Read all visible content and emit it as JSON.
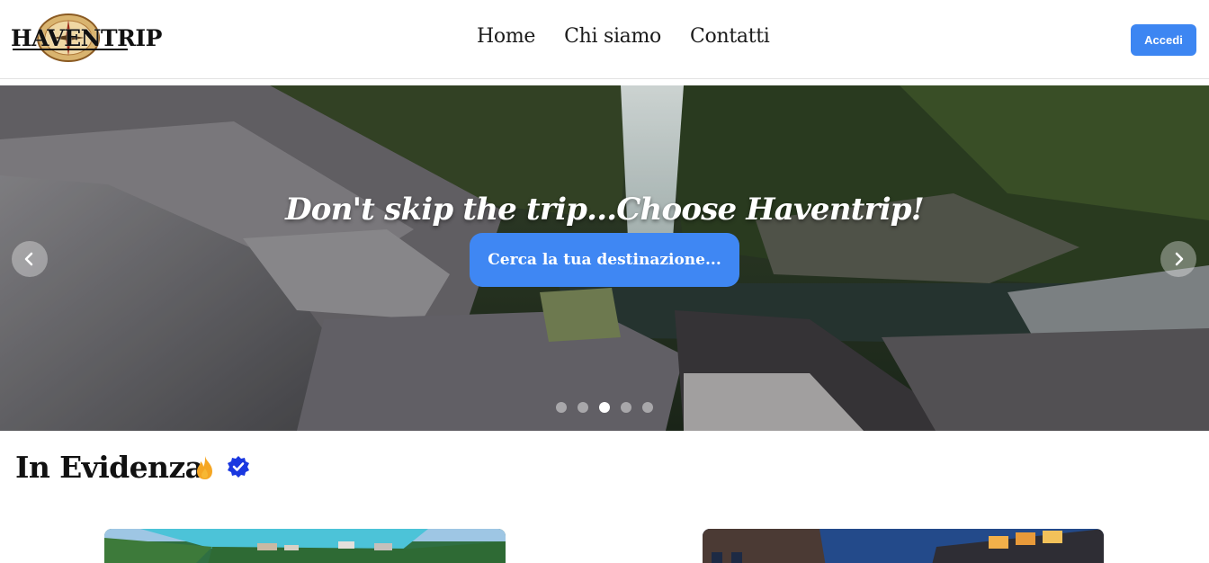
{
  "header": {
    "logo_text": "HAVENTRIP",
    "nav": [
      {
        "label": "Home"
      },
      {
        "label": "Chi siamo"
      },
      {
        "label": "Contatti"
      }
    ],
    "login_label": "Accedi"
  },
  "hero": {
    "title": "Don't skip the trip...Choose Haventrip!",
    "cta_label": "Cerca la tua destinazione...",
    "slides_total": 5,
    "active_slide": 3
  },
  "featured": {
    "title": "In Evidenza"
  },
  "colors": {
    "primary": "#3d86f2",
    "flame": "#f5a623",
    "verified": "#1a38e0"
  }
}
